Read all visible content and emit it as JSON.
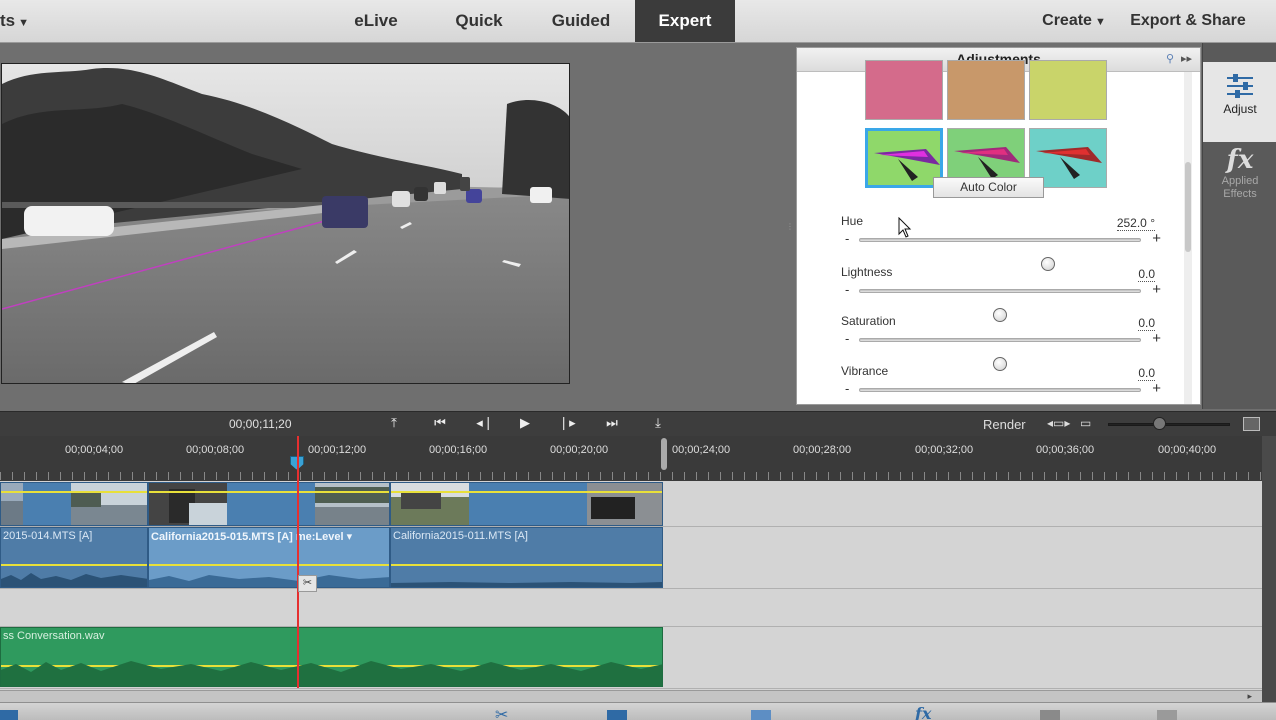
{
  "topbar": {
    "mode_left": "ts",
    "mode_elive": "eLive",
    "mode_quick": "Quick",
    "mode_guided": "Guided",
    "mode_expert": "Expert",
    "create": "Create",
    "export_share": "Export & Share"
  },
  "adjustments": {
    "title": "Adjustments",
    "auto_color": "Auto Color",
    "sliders": [
      {
        "label": "Hue",
        "value": "252.0 °",
        "level": 0.67
      },
      {
        "label": "Lightness",
        "value": "0.0",
        "level": 0.5
      },
      {
        "label": "Saturation",
        "value": "0.0",
        "level": 0.5
      },
      {
        "label": "Vibrance",
        "value": "0.0",
        "level": 0.5
      }
    ]
  },
  "side_tools": {
    "adjust_label": "Adjust",
    "fx_icon": "fx",
    "applied_effects_label_1": "Applied",
    "applied_effects_label_2": "Effects"
  },
  "transport": {
    "timecode": "00;00;11;20",
    "render": "Render"
  },
  "ruler": {
    "labels": [
      "00;00;04;00",
      "00;00;08;00",
      "00;00;12;00",
      "00;00;16;00",
      "00;00;20;00",
      "00;00;24;00",
      "00;00;28;00",
      "00;00;32;00",
      "00;00;36;00",
      "00;00;40;00"
    ]
  },
  "timeline": {
    "clip_a": "2015-014.MTS [A]",
    "clip_b": "California2015-015.MTS [A]  me:Level ▾",
    "clip_c": "California2015-011.MTS [A]",
    "music": "ss Conversation.wav"
  },
  "colors": {
    "accent": "#3aa7e8",
    "playhead": "#e53030",
    "clip_blue": "#4a7fb0",
    "audio_green": "#2f9a5e"
  }
}
